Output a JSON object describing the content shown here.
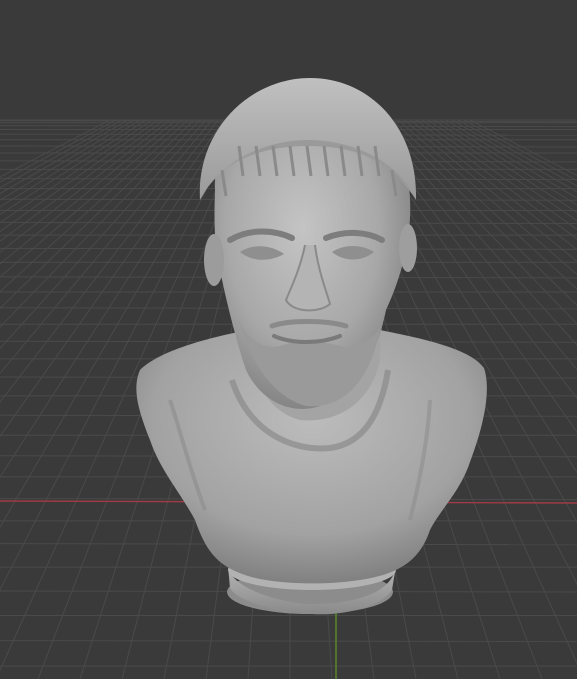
{
  "viewport": {
    "background": "#3a3a3a",
    "grid_color": "#4a4a4a",
    "x_axis_color": "#a03a44",
    "y_axis_color": "#5c8a2a",
    "model_name": "",
    "model_color": "#a9a9a9"
  }
}
